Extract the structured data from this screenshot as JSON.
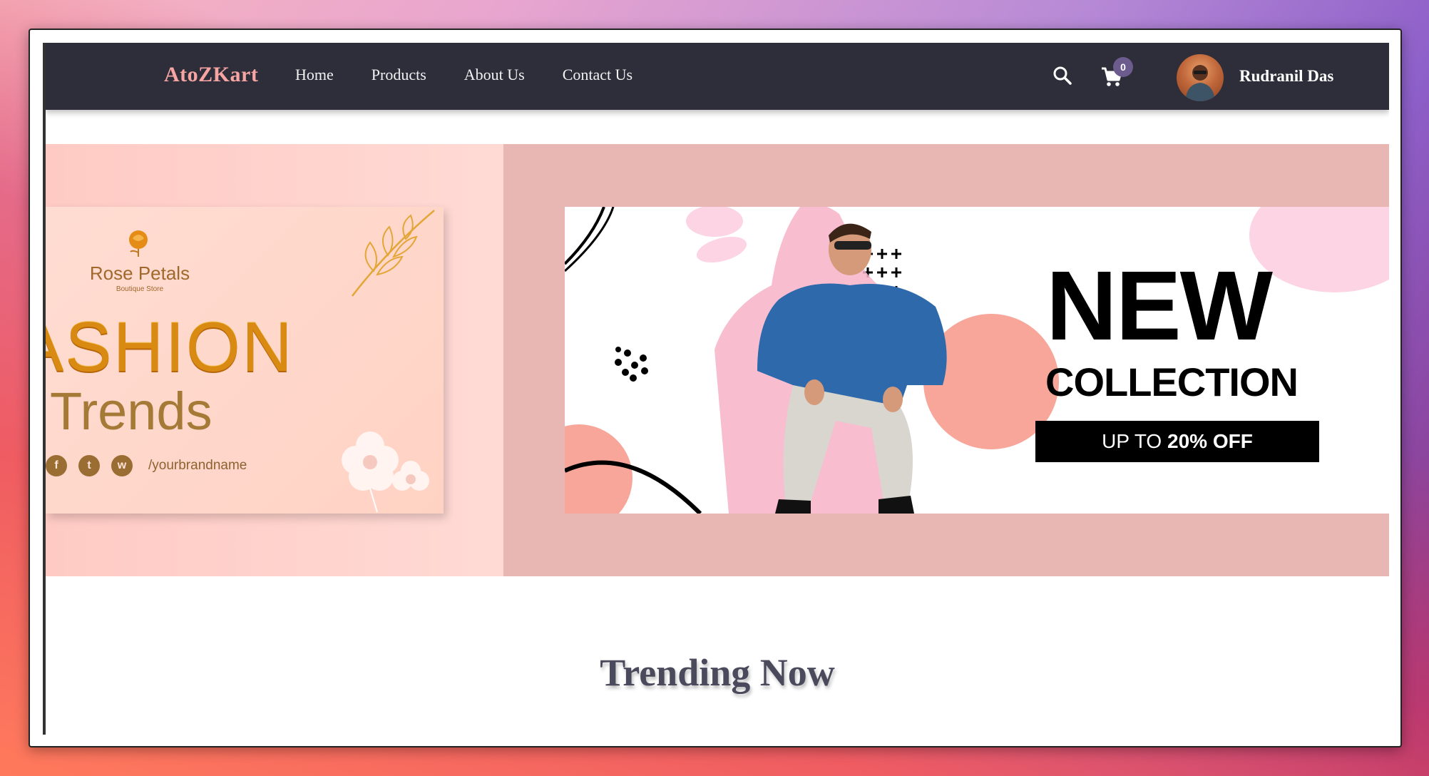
{
  "navbar": {
    "brand": "AtoZKart",
    "links": [
      "Home",
      "Products",
      "About Us",
      "Contact Us"
    ],
    "cart_count": "0",
    "user_name": "Rudranil Das"
  },
  "carousel": {
    "left_slide": {
      "brand": "Rose Petals",
      "subtitle": "Boutique Store",
      "headline": "ASHION",
      "headline2": "Trends",
      "social_handle": "/yourbrandname",
      "social_icons": [
        "f",
        "t",
        "w"
      ]
    },
    "right_slide": {
      "headline": "NEW",
      "subheadline": "COLLECTION",
      "offer_prefix": "UP TO ",
      "offer_value": "20% OFF"
    }
  },
  "section": {
    "title": "Trending Now"
  },
  "colors": {
    "navbar_bg": "#2e2d3a",
    "brand": "#f6a5a2",
    "right_slide_bg": "#e8b7b4",
    "accent_pink": "#f9a79a"
  }
}
